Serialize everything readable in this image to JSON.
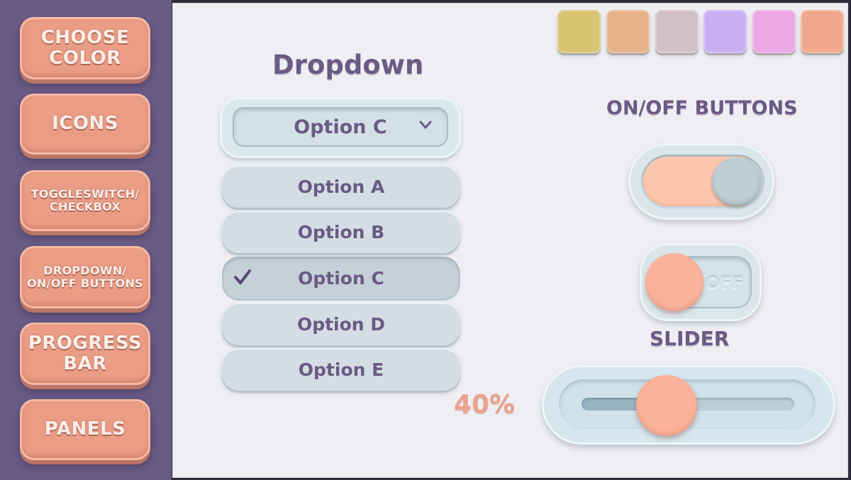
{
  "sidebar": {
    "items": [
      {
        "label": "CHOOSE\nCOLOR"
      },
      {
        "label": "ICONS"
      },
      {
        "label": "TOGGLESWITCH/\nCHECKBOX"
      },
      {
        "label": "DROPDOWN/\nON/OFF BUTTONS"
      },
      {
        "label": "PROGRESS\nBAR"
      },
      {
        "label": "PANELS"
      }
    ]
  },
  "colors": {
    "sidebar_bg": "#675a85",
    "button_bg": "#eb9c84",
    "panel_bg": "#efeff3",
    "heading_text": "#6a5a84",
    "accent_peach": "#fbb29b"
  },
  "swatches": [
    {
      "color": "#d9c473"
    },
    {
      "color": "#e6b38a"
    },
    {
      "color": "#d3c0c4"
    },
    {
      "color": "#c9aff2"
    },
    {
      "color": "#eba8e4"
    },
    {
      "color": "#f2a88e"
    }
  ],
  "dropdown": {
    "heading": "Dropdown",
    "selected": "Option C",
    "chevron_icon": "chevron-down-icon",
    "options": [
      "Option A",
      "Option B",
      "Option C",
      "Option D",
      "Option E"
    ],
    "selected_index": 2,
    "check_icon": "checkmark-icon"
  },
  "onoff": {
    "heading": "ON/OFF BUTTONS",
    "toggle1_on": true,
    "toggle2_label": "OFF",
    "toggle2_on": false
  },
  "slider": {
    "heading": "SLIDER",
    "value_label": "40%",
    "value": 0.4
  }
}
